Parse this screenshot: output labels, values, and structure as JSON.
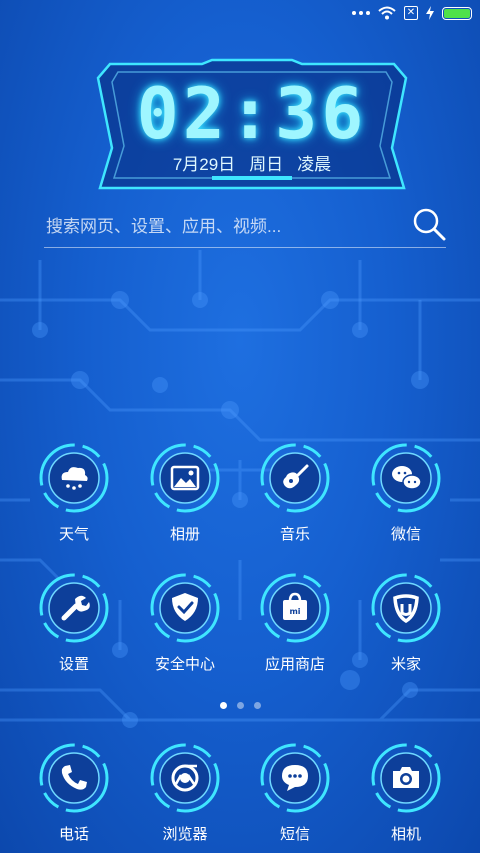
{
  "status_bar": {
    "icons": [
      "more-dots-icon",
      "wifi-icon",
      "sim-x-icon",
      "charging-bolt-icon",
      "battery-icon"
    ],
    "battery_color": "#4fe14a"
  },
  "clock": {
    "time": "02:36",
    "date": "7月29日",
    "weekday": "周日",
    "period": "凌晨"
  },
  "search": {
    "placeholder": "搜索网页、设置、应用、视频..."
  },
  "apps": [
    {
      "label": "天气",
      "icon": "weather-cloud-rain-icon"
    },
    {
      "label": "相册",
      "icon": "gallery-image-icon"
    },
    {
      "label": "音乐",
      "icon": "guitar-icon"
    },
    {
      "label": "微信",
      "icon": "wechat-icon"
    },
    {
      "label": "设置",
      "icon": "wrench-icon"
    },
    {
      "label": "安全中心",
      "icon": "shield-check-icon"
    },
    {
      "label": "应用商店",
      "icon": "shopping-bag-mi-icon"
    },
    {
      "label": "米家",
      "icon": "mijia-icon"
    }
  ],
  "pager": {
    "pages": 3,
    "active": 1
  },
  "dock": [
    {
      "label": "电话",
      "icon": "phone-icon"
    },
    {
      "label": "浏览器",
      "icon": "browser-icon"
    },
    {
      "label": "短信",
      "icon": "message-bubble-icon"
    },
    {
      "label": "相机",
      "icon": "camera-icon"
    }
  ],
  "colors": {
    "background": "#155fcf",
    "accent": "#3fe6ff",
    "clock_glow": "#9ff6ff"
  }
}
